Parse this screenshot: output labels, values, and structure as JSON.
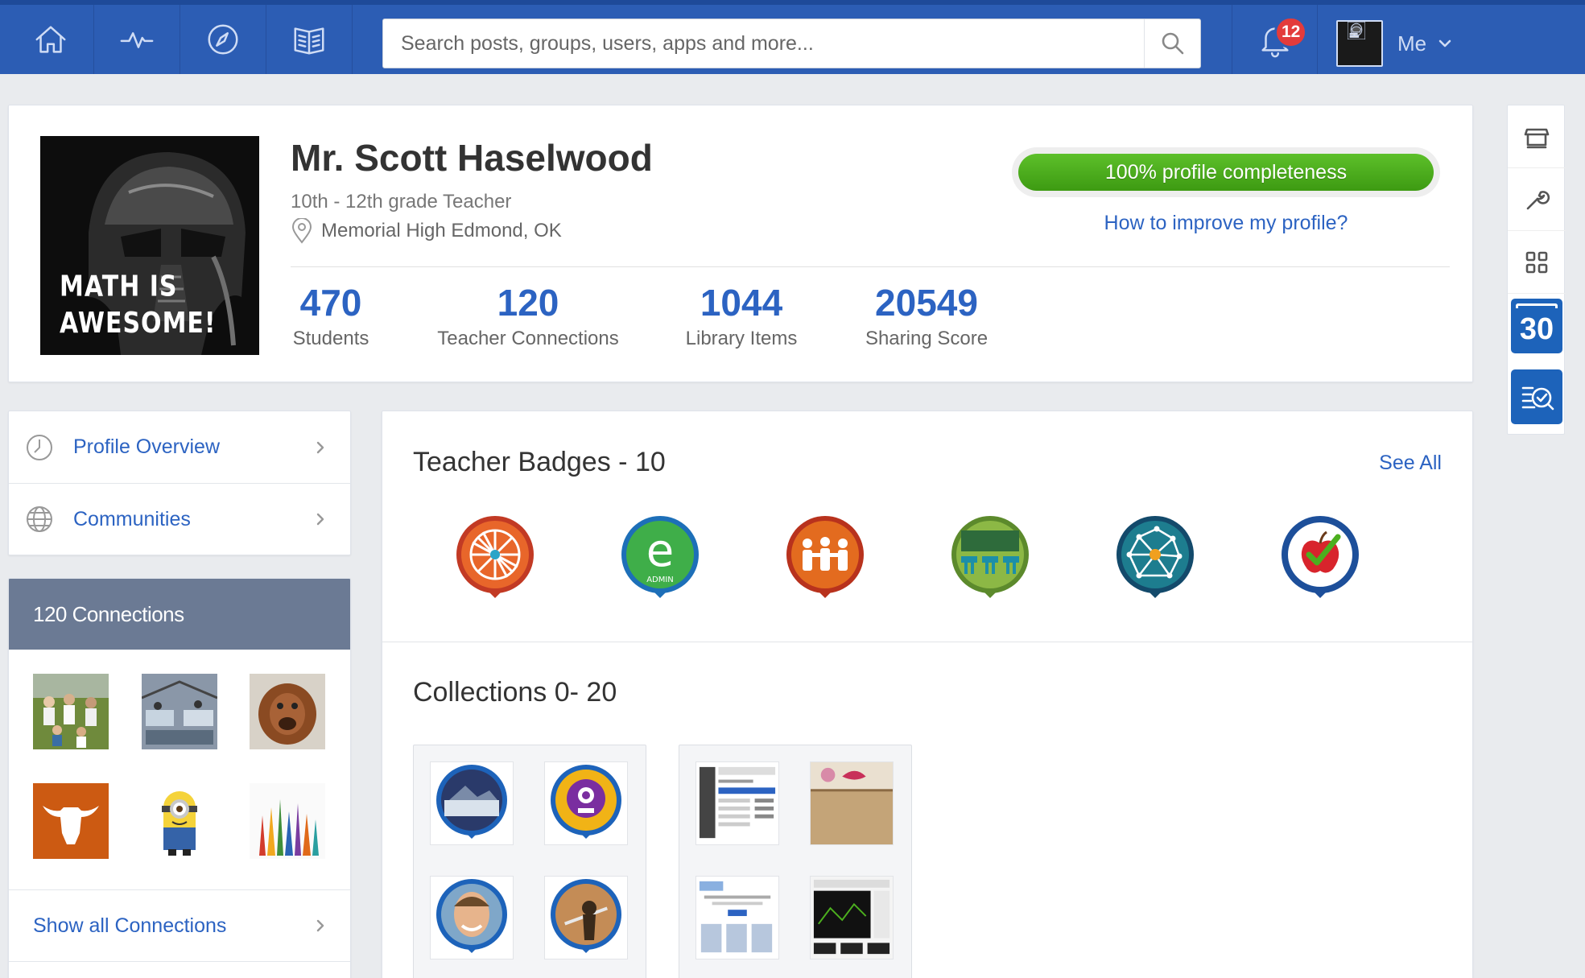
{
  "nav": {
    "icons": [
      "home-icon",
      "activity-icon",
      "compass-icon",
      "library-book-icon"
    ],
    "search_placeholder": "Search posts, groups, users, apps and more...",
    "notification_count": "12",
    "me_label": "Me"
  },
  "profile": {
    "name": "Mr. Scott Haselwood",
    "role": "10th - 12th grade Teacher",
    "location": "Memorial High Edmond, OK",
    "picture_caption_line1": "MATH IS",
    "picture_caption_line2": "AWESOME!",
    "completeness_label": "100% profile completeness",
    "completeness_fraction": 1.0,
    "improve_link": "How to improve my profile?",
    "stats": [
      {
        "value": "470",
        "label": "Students"
      },
      {
        "value": "120",
        "label": "Teacher Connections"
      },
      {
        "value": "1044",
        "label": "Library Items"
      },
      {
        "value": "20549",
        "label": "Sharing Score"
      }
    ]
  },
  "tools": {
    "icons": [
      "store-icon",
      "wrench-icon",
      "apps-grid-icon",
      "calendar-icon",
      "quiz-search-icon"
    ],
    "calendar_day": "30"
  },
  "sidebar": {
    "items": [
      {
        "label": "Profile Overview",
        "icon": "clock-icon"
      },
      {
        "label": "Communities",
        "icon": "globe-icon"
      }
    ]
  },
  "connections": {
    "header": "120 Connections",
    "show_all": "Show all Connections"
  },
  "badges": {
    "title": "Teacher Badges",
    "count_text": " - 10",
    "see_all": "See All",
    "admin_label": "ADMIN",
    "colors": [
      "#e8662a",
      "#3fae49",
      "#e36b1f",
      "#6ea33a",
      "#1d7d8f",
      "#ffffff"
    ]
  },
  "collections": {
    "title": "Collections 0- 20"
  },
  "colors": {
    "nav_bg": "#2c5db4",
    "accent": "#2c63c2",
    "progress_green": "#4caf1e",
    "notification_red": "#e33b3b",
    "connections_header": "#6b7a94"
  }
}
